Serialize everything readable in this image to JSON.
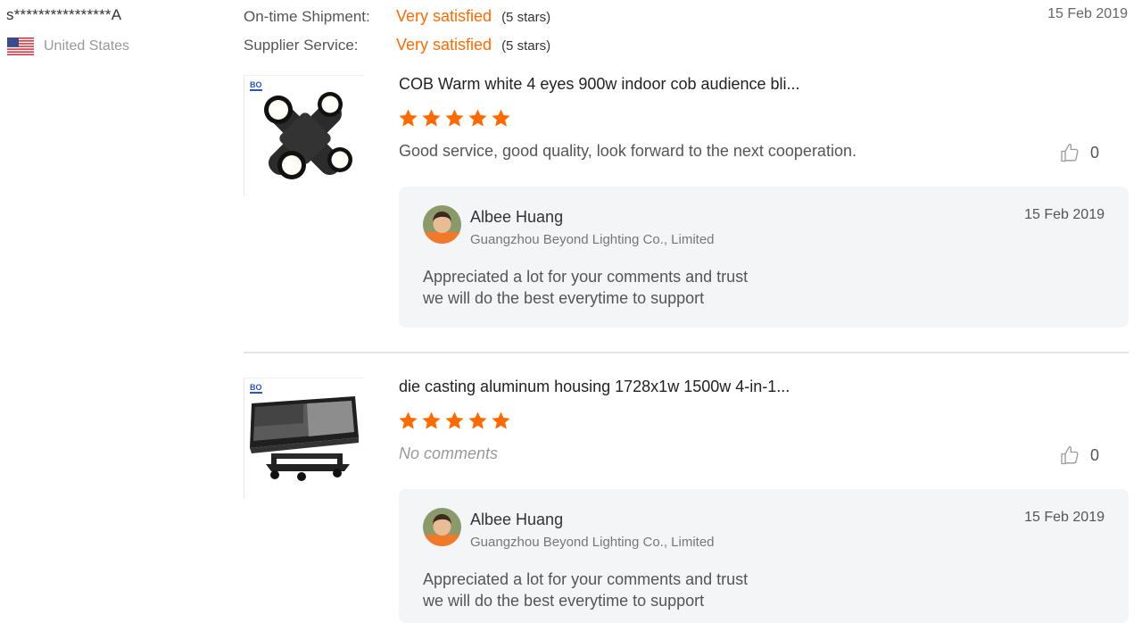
{
  "reviewer": {
    "name": "s****************A",
    "country": "United States",
    "flag_icon": "us-flag-icon"
  },
  "ratings": {
    "shipment": {
      "label": "On-time Shipment:",
      "value": "Very satisfied",
      "stars_text": "(5 stars)"
    },
    "service": {
      "label": "Supplier Service:",
      "value": "Very satisfied",
      "stars_text": "(5 stars)"
    },
    "date": "15 Feb 2019"
  },
  "colors": {
    "accent": "#ff6a00",
    "reply_bg": "#f4f5f7"
  },
  "reviews": [
    {
      "product_title": "COB Warm white 4 eyes 900w indoor cob audience bli...",
      "rating": 5,
      "comment": "Good service, good quality, look forward to the next cooperation.",
      "likes": "0",
      "thumb_logo": "BO",
      "reply": {
        "name": "Albee Huang",
        "company": "Guangzhou Beyond Lighting Co., Limited",
        "date": "15 Feb 2019",
        "line1": "Appreciated a lot for your comments and trust",
        "line2": "we will do the best everytime to support"
      }
    },
    {
      "product_title": "die casting aluminum housing 1728x1w 1500w 4-in-1...",
      "rating": 5,
      "comment": "No comments",
      "likes": "0",
      "thumb_logo": "BO",
      "reply": {
        "name": "Albee Huang",
        "company": "Guangzhou Beyond Lighting Co., Limited",
        "date": "15 Feb 2019",
        "line1": "Appreciated a lot for your comments and trust",
        "line2": "we will do the best everytime to support"
      }
    }
  ]
}
